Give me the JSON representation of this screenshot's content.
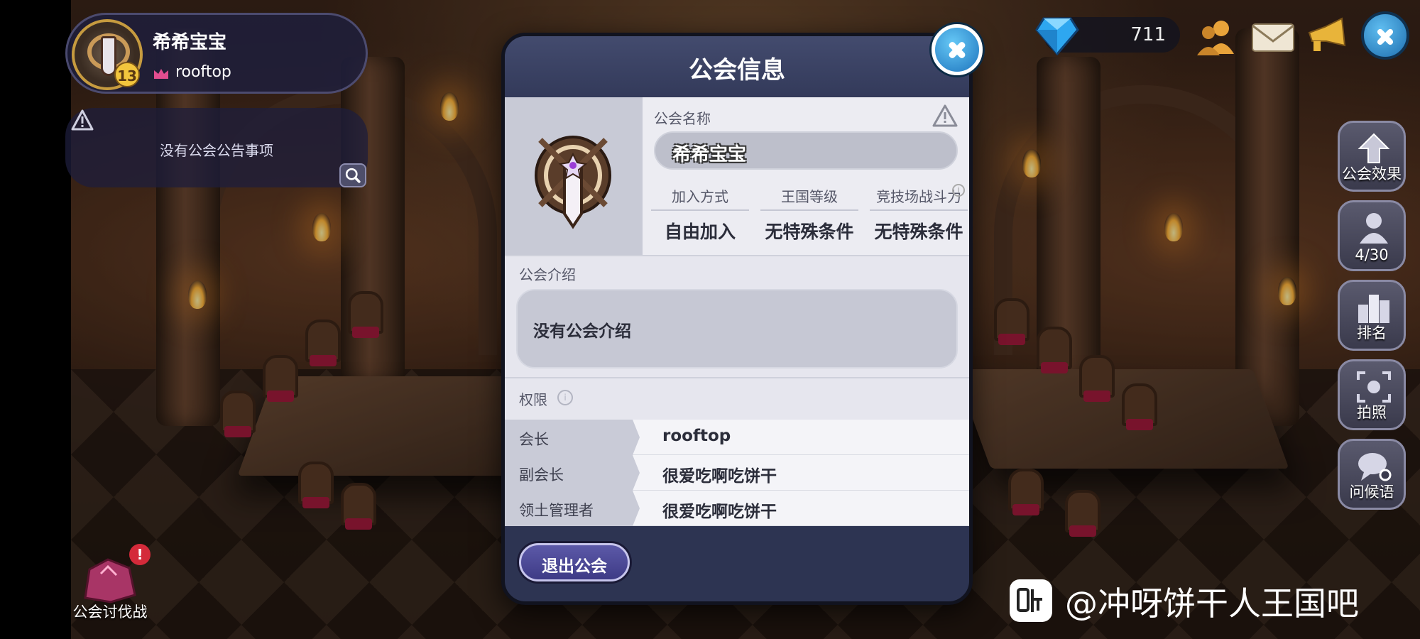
{
  "profile": {
    "name": "希希宝宝",
    "level": "13",
    "subtitle": "rooftop"
  },
  "notice": {
    "text": "没有公会公告事项"
  },
  "hud": {
    "gems": "711"
  },
  "side_buttons": [
    {
      "label": "公会效果",
      "icon": "arrow-up-icon"
    },
    {
      "label": "4/30",
      "icon": "member-icon"
    },
    {
      "label": "排名",
      "icon": "ranking-icon"
    },
    {
      "label": "拍照",
      "icon": "camera-icon"
    },
    {
      "label": "问候语",
      "icon": "chat-settings-icon"
    }
  ],
  "raid": {
    "label": "公会讨伐战",
    "alert": "!"
  },
  "dialog": {
    "title": "公会信息",
    "guild_name_label": "公会名称",
    "guild_name": "希希宝宝",
    "requirements": [
      {
        "label": "加入方式",
        "value": "自由加入"
      },
      {
        "label": "王国等级",
        "value": "无特殊条件"
      },
      {
        "label": "竞技场战斗力",
        "value": "无特殊条件"
      }
    ],
    "intro_label": "公会介绍",
    "intro_text": "没有公会介绍",
    "permissions_label": "权限",
    "permissions": [
      {
        "role": "会长",
        "name": "rooftop"
      },
      {
        "role": "副会长",
        "name": "很爱吃啊吃饼干"
      },
      {
        "role": "领土管理者",
        "name": "很爱吃啊吃饼干"
      }
    ],
    "leave_button": "退出公会"
  },
  "watermark": {
    "text": "@冲呀饼干人王国吧"
  },
  "colors": {
    "dialog_bg": "#2d3452",
    "accent_blue": "#1d74bd",
    "leave_button": "#4a47a0",
    "gold": "#c69b3f"
  }
}
